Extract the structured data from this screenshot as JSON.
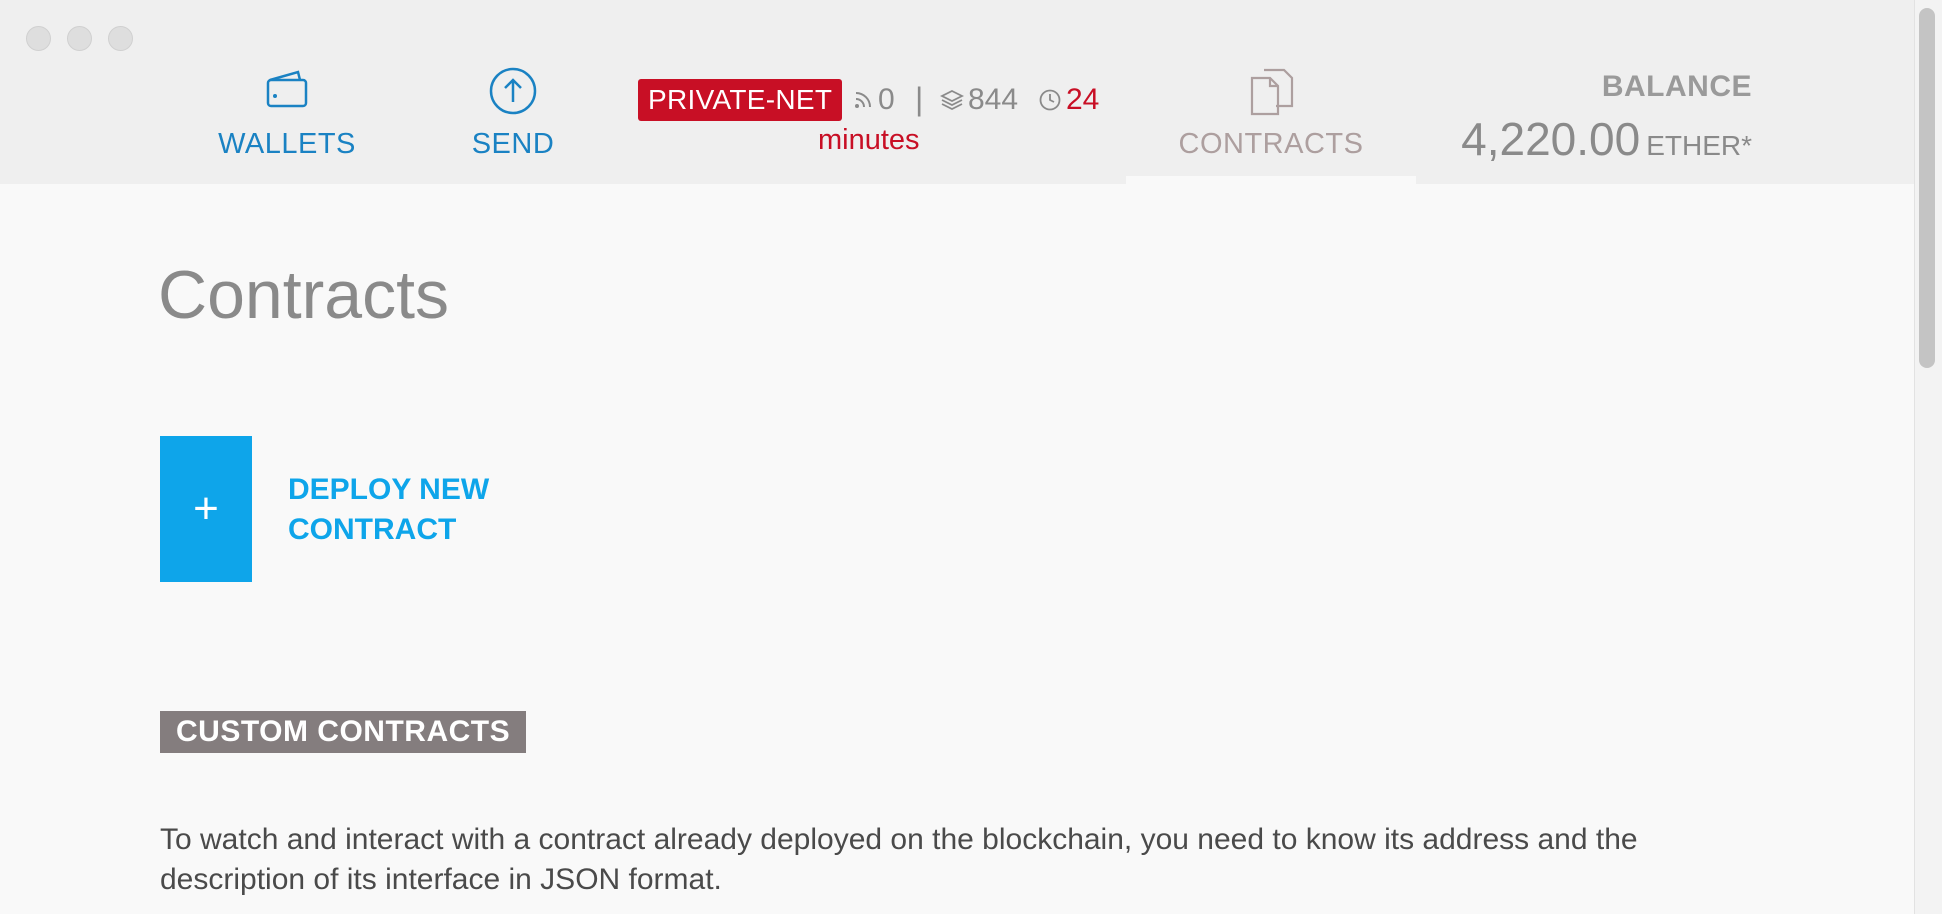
{
  "nav": {
    "wallets": {
      "label": "WALLETS",
      "icon": "wallet-icon"
    },
    "send": {
      "label": "SEND",
      "icon": "arrow-up-circle-icon"
    },
    "contracts": {
      "label": "CONTRACTS",
      "icon": "documents-icon"
    }
  },
  "status": {
    "network": "PRIVATE-NET",
    "peers": "0",
    "separator": "|",
    "blocks": "844",
    "time_value": "24",
    "time_unit": "minutes"
  },
  "balance": {
    "label": "BALANCE",
    "amount": "4,220.00",
    "unit": "ETHER*"
  },
  "page": {
    "title": "Contracts",
    "deploy": {
      "plus": "+",
      "label": "DEPLOY NEW CONTRACT"
    },
    "section_heading": "CUSTOM CONTRACTS",
    "description": "To watch and interact with a contract already deployed on the blockchain, you need to know its address and the description of its interface in JSON format."
  },
  "colors": {
    "accent_blue": "#0ea5ea",
    "nav_blue": "#1a82c3",
    "network_red": "#c80f25",
    "heading_bg": "#847d7e"
  }
}
